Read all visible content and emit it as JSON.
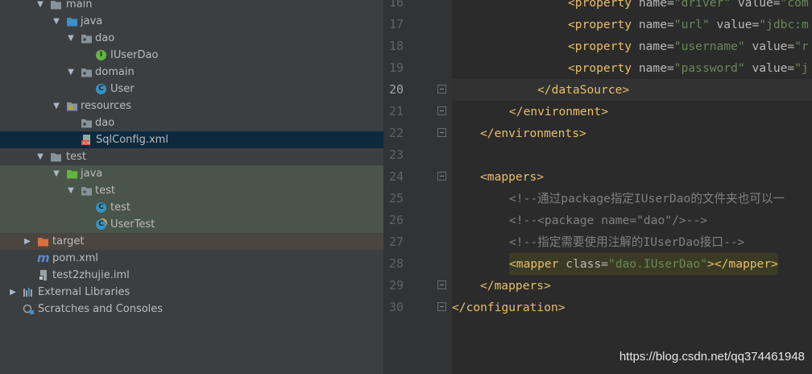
{
  "tree": [
    {
      "label": "main",
      "icon": "folder-icon"
    },
    {
      "label": "java",
      "icon": "source-folder-icon"
    },
    {
      "label": "dao",
      "icon": "package-icon"
    },
    {
      "label": "IUserDao",
      "icon": "interface-icon",
      "badge": "I"
    },
    {
      "label": "domain",
      "icon": "package-icon"
    },
    {
      "label": "User",
      "icon": "class-icon",
      "badge": "C"
    },
    {
      "label": "resources",
      "icon": "resources-folder-icon"
    },
    {
      "label": "dao",
      "icon": "package-icon"
    },
    {
      "label": "SqlConfig.xml",
      "icon": "xml-file-icon"
    },
    {
      "label": "test",
      "icon": "folder-icon"
    },
    {
      "label": "java",
      "icon": "test-source-folder-icon"
    },
    {
      "label": "test",
      "icon": "package-icon"
    },
    {
      "label": "test",
      "icon": "class-icon",
      "badge": "C"
    },
    {
      "label": "UserTest",
      "icon": "test-class-icon",
      "badge": "C"
    },
    {
      "label": "target",
      "icon": "excluded-folder-icon"
    },
    {
      "label": "pom.xml",
      "icon": "maven-icon",
      "glyph": "m"
    },
    {
      "label": "test2zhujie.iml",
      "icon": "iml-file-icon"
    },
    {
      "label": "External Libraries",
      "icon": "libraries-icon"
    },
    {
      "label": "Scratches and Consoles",
      "icon": "scratches-icon"
    }
  ],
  "editor": {
    "line_numbers": [
      "16",
      "17",
      "18",
      "19",
      "20",
      "21",
      "22",
      "23",
      "24",
      "25",
      "26",
      "27",
      "28",
      "29",
      "30"
    ],
    "lines": {
      "l16": {
        "open": "<property",
        "name_attr": " name=",
        "name_val": "\"driver\"",
        "value_attr": " value=",
        "value_val": "\"com"
      },
      "l17": {
        "open": "<property",
        "name_attr": " name=",
        "name_val": "\"url\"",
        "value_attr": " value=",
        "value_val": "\"jdbc:m"
      },
      "l18": {
        "open": "<property",
        "name_attr": " name=",
        "name_val": "\"username\"",
        "value_attr": " value=",
        "value_val": "\"r"
      },
      "l19": {
        "open": "<property",
        "name_attr": " name=",
        "name_val": "\"password\"",
        "value_attr": " value=",
        "value_val": "\"j"
      },
      "l20": "</dataSource>",
      "l21": "</environment>",
      "l22": "</environments>",
      "l24": "<mappers>",
      "l25": "<!--通过package指定IUserDao的文件夹也可以一",
      "l26": "<!--<package name=\"dao\"/>-->",
      "l27": "<!--指定需要使用注解的IUserDao接口-->",
      "l28": {
        "open": "<mapper",
        "class_attr": " class=",
        "class_val": "\"dao.IUserDao\"",
        "close": "></mapper>"
      },
      "l29": "</mappers>",
      "l30": "</configuration>"
    }
  },
  "watermark": "https://blog.csdn.net/qq374461948",
  "colors": {
    "tag": "#e8bf6a",
    "attr": "#bababa",
    "value": "#6a8759",
    "comment": "#808080",
    "selection": "#0d293e"
  }
}
